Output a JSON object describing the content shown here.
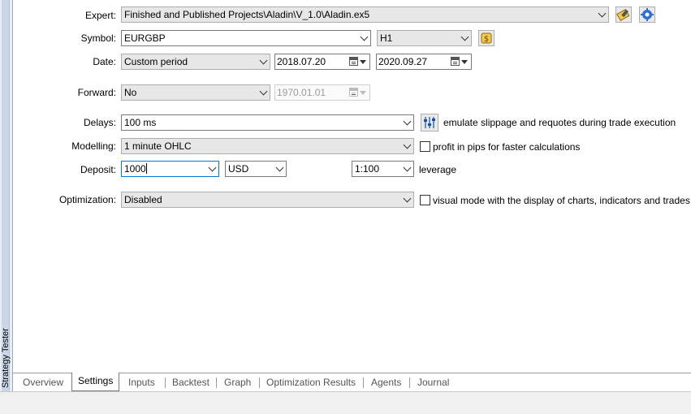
{
  "window": {
    "panel_title": "Strategy Tester"
  },
  "colors": {
    "accent": "#0078d7",
    "icon_yellow": "#f2c94c",
    "icon_blue": "#2b6fd6"
  },
  "labels": {
    "expert": "Expert:",
    "symbol": "Symbol:",
    "date": "Date:",
    "forward": "Forward:",
    "delays": "Delays:",
    "modelling": "Modelling:",
    "deposit": "Deposit:",
    "optimization": "Optimization:"
  },
  "expert": {
    "value": "Finished and Published Projects\\Aladin\\V_1.0\\Aladin.ex5",
    "icons": [
      "edit-icon",
      "settings-gear-icon"
    ]
  },
  "symbol": {
    "value": "EURGBP",
    "timeframe": "H1",
    "icon": "symbol-properties-icon"
  },
  "date": {
    "period": "Custom period",
    "from": "2018.07.20",
    "to": "2020.09.27"
  },
  "forward": {
    "value": "No",
    "date": "1970.01.01"
  },
  "delays": {
    "value": "100 ms",
    "icon": "sliders-icon",
    "description": "emulate slippage and requotes during trade execution"
  },
  "modelling": {
    "value": "1 minute OHLC",
    "checkbox_label": "profit in pips for faster calculations",
    "checked": false
  },
  "deposit": {
    "amount": "1000",
    "currency": "USD",
    "leverage": "1:100",
    "leverage_label": "leverage"
  },
  "optimization": {
    "value": "Disabled",
    "checkbox_label": "visual mode with the display of charts, indicators and trades",
    "checked": false
  },
  "tabs": [
    {
      "label": "Overview",
      "active": false
    },
    {
      "label": "Settings",
      "active": true
    },
    {
      "label": "Inputs",
      "active": false
    },
    {
      "label": "Backtest",
      "active": false
    },
    {
      "label": "Graph",
      "active": false
    },
    {
      "label": "Optimization Results",
      "active": false
    },
    {
      "label": "Agents",
      "active": false
    },
    {
      "label": "Journal",
      "active": false
    }
  ]
}
